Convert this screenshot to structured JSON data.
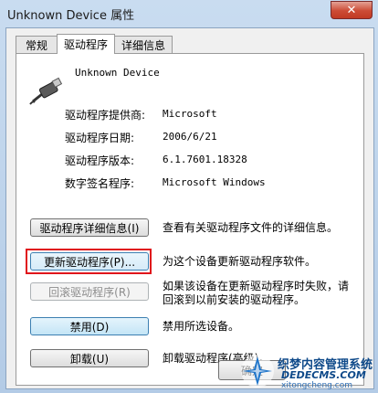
{
  "window": {
    "title": "Unknown Device 属性",
    "close_glyph": "✕"
  },
  "tabs": [
    {
      "label": "常规"
    },
    {
      "label": "驱动程序"
    },
    {
      "label": "详细信息"
    }
  ],
  "device": {
    "name": "Unknown Device"
  },
  "info": [
    {
      "label": "驱动程序提供商:",
      "value": "Microsoft"
    },
    {
      "label": "驱动程序日期:",
      "value": "2006/6/21"
    },
    {
      "label": "驱动程序版本:",
      "value": "6.1.7601.18328"
    },
    {
      "label": "数字签名程序:",
      "value": "Microsoft Windows"
    }
  ],
  "actions": [
    {
      "button": "驱动程序详细信息(I)",
      "description": "查看有关驱动程序文件的详细信息。"
    },
    {
      "button": "更新驱动程序(P)...",
      "description": "为这个设备更新驱动程序软件。"
    },
    {
      "button": "回滚驱动程序(R)",
      "description": "如果该设备在更新驱动程序时失败，请回滚到以前安装的驱动程序。"
    },
    {
      "button": "禁用(D)",
      "description": "禁用所选设备。"
    },
    {
      "button": "卸载(U)",
      "description": "卸载驱动程序(高级)。"
    }
  ],
  "footer": {
    "ok_label": "确定"
  },
  "watermark": {
    "line1": "织梦内容管理系统",
    "line2": "DEDECMS.COM",
    "line3": "xitongcheng.com"
  },
  "colors": {
    "highlight": "#e0141b",
    "close_button": "#c13a24"
  }
}
